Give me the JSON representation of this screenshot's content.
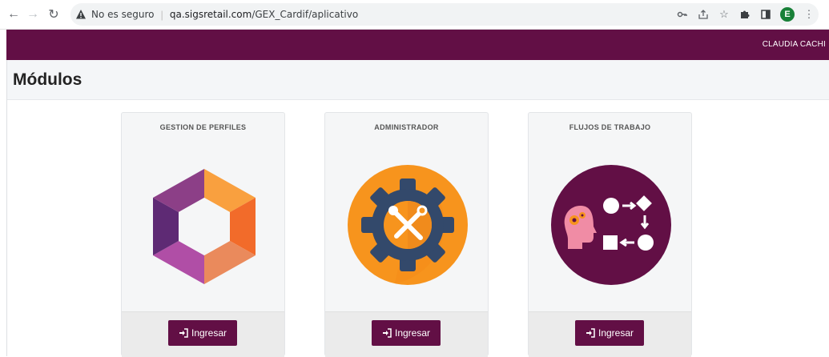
{
  "browser": {
    "security_label": "No es seguro",
    "url_host": "qa.sigsretail.com",
    "url_path": "/GEX_Cardif/aplicativo",
    "profile_initial": "E"
  },
  "header": {
    "user_name": "CLAUDIA CACHI",
    "brand_color": "#620f45"
  },
  "page": {
    "title": "Módulos"
  },
  "modules": [
    {
      "title": "GESTION DE PERFILES",
      "button_label": "Ingresar",
      "icon": "hexagon-logo-icon"
    },
    {
      "title": "ADMINISTRADOR",
      "button_label": "Ingresar",
      "icon": "gear-tools-icon"
    },
    {
      "title": "FLUJOS DE TRABAJO",
      "button_label": "Ingresar",
      "icon": "workflow-head-icon"
    }
  ]
}
